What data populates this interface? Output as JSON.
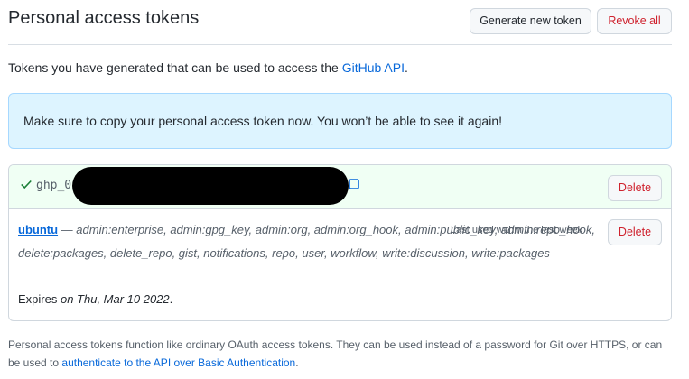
{
  "header": {
    "title": "Personal access tokens",
    "generate_label": "Generate new token",
    "revoke_label": "Revoke all"
  },
  "intro": {
    "text_before": "Tokens you have generated that can be used to access the ",
    "link_text": "GitHub API",
    "text_after": "."
  },
  "flash": {
    "message": "Make sure to copy your personal access token now. You won’t be able to see it again!"
  },
  "new_token": {
    "value_prefix": "ghp_0",
    "delete_label": "Delete",
    "icons": [
      "check-icon",
      "copy-icon"
    ]
  },
  "token": {
    "name": "ubuntu",
    "separator": " — ",
    "scopes": "admin:enterprise, admin:gpg_key, admin:org, admin:org_hook, admin:public_key, admin:repo_hook, delete:packages, delete_repo, gist, notifications, repo, user, workflow, write:discussion, write:packages",
    "last_used": "Last used within the last week",
    "delete_label": "Delete",
    "expires_label": "Expires",
    "expires_value": " on Thu, Mar 10 2022",
    "expires_suffix": "."
  },
  "footer": {
    "text": "Personal access tokens function like ordinary OAuth access tokens. They can be used instead of a password for Git over HTTPS, or can be used to ",
    "link_text": "authenticate to the API over Basic Authentication",
    "text_after": "."
  },
  "colors": {
    "link": "#0969da",
    "danger": "#cf222e",
    "flash_bg": "#ddf4ff",
    "success_bg": "#f0fff4"
  }
}
